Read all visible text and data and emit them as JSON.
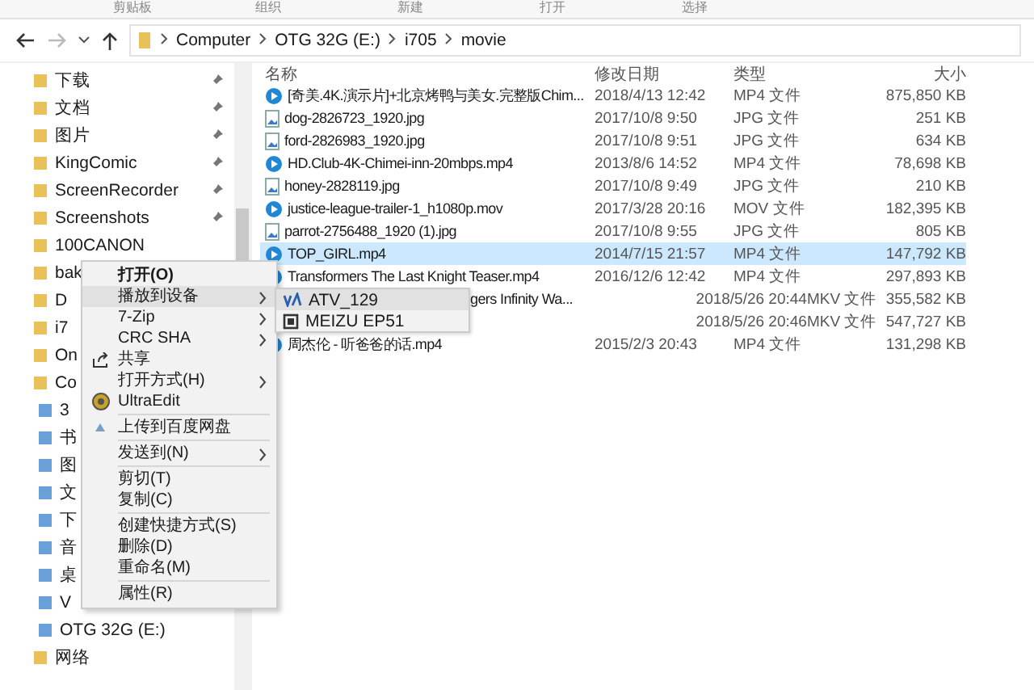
{
  "ribbon": {
    "groups": [
      "剪贴板",
      "组织",
      "新建",
      "打开",
      "选择"
    ]
  },
  "address_bar": {
    "path": [
      "Computer",
      "OTG 32G (E:)",
      "i705",
      "movie"
    ]
  },
  "sidebar": {
    "items": [
      {
        "label": "下载",
        "pinned": true
      },
      {
        "label": "文档",
        "pinned": true
      },
      {
        "label": "图片",
        "pinned": true
      },
      {
        "label": "KingComic",
        "pinned": true
      },
      {
        "label": "ScreenRecorder",
        "pinned": true
      },
      {
        "label": "Screenshots",
        "pinned": true
      },
      {
        "label": "100CANON",
        "pinned": false
      },
      {
        "label": "bak"
      },
      {
        "label": "D"
      },
      {
        "label": "i7"
      },
      {
        "label": "On"
      },
      {
        "label": "Co",
        "children": [
          {
            "label": "3"
          },
          {
            "label": "书"
          },
          {
            "label": "图"
          },
          {
            "label": "文"
          },
          {
            "label": "下"
          },
          {
            "label": "音"
          },
          {
            "label": "桌"
          },
          {
            "label": "V"
          },
          {
            "label": "OTG 32G (E:)"
          }
        ]
      },
      {
        "label": "网络"
      }
    ]
  },
  "table": {
    "columns": [
      "名称",
      "修改日期",
      "类型",
      "大小"
    ],
    "rows": [
      {
        "kind": "video",
        "name": "[奇美.4K.演示片]+北京烤鸭与美女.完整版Chim...",
        "date": "2018/4/13 12:42",
        "type": "MP4 文件",
        "size": "875,850 KB",
        "selected": false
      },
      {
        "kind": "image",
        "name": "dog-2826723_1920.jpg",
        "date": "2017/10/8 9:50",
        "type": "JPG 文件",
        "size": "251 KB",
        "selected": false
      },
      {
        "kind": "image",
        "name": "ford-2826983_1920.jpg",
        "date": "2017/10/8 9:51",
        "type": "JPG 文件",
        "size": "634 KB",
        "selected": false
      },
      {
        "kind": "video",
        "name": "HD.Club-4K-Chimei-inn-20mbps.mp4",
        "date": "2013/8/6 14:52",
        "type": "MP4 文件",
        "size": "78,698 KB",
        "selected": false
      },
      {
        "kind": "image",
        "name": "honey-2828119.jpg",
        "date": "2017/10/8 9:49",
        "type": "JPG 文件",
        "size": "210 KB",
        "selected": false
      },
      {
        "kind": "video",
        "name": "justice-league-trailer-1_h1080p.mov",
        "date": "2017/3/28 20:16",
        "type": "MOV 文件",
        "size": "182,395 KB",
        "selected": false
      },
      {
        "kind": "image",
        "name": "parrot-2756488_1920 (1).jpg",
        "date": "2017/10/8 9:55",
        "type": "JPG 文件",
        "size": "805 KB",
        "selected": false
      },
      {
        "kind": "video",
        "name": "TOP_GIRL.mp4",
        "date": "2014/7/15 21:57",
        "type": "MP4 文件",
        "size": "147,792 KB",
        "selected": true
      },
      {
        "kind": "video",
        "name": "Transformers The Last Knight Teaser.mp4",
        "date": "2016/12/6 12:42",
        "type": "MP4 文件",
        "size": "297,893 KB",
        "selected": false
      },
      {
        "kind": "covered",
        "name": "gers Infinity Wa...",
        "date": "2018/5/26 20:44",
        "type": "MKV 文件",
        "size": "355,582 KB",
        "selected": false
      },
      {
        "kind": "covered",
        "date": "2018/5/26 20:46",
        "type": "MKV 文件",
        "size": "547,727 KB",
        "selected": false
      },
      {
        "kind": "video",
        "name": "周杰伦 - 听爸爸的话.mp4",
        "date": "2015/2/3 20:43",
        "type": "MP4 文件",
        "size": "131,298 KB",
        "selected": false
      }
    ]
  },
  "context_menu": {
    "items": [
      {
        "kind": "plain",
        "label": "打开(O)",
        "bold": true,
        "submenu": false,
        "selected": false
      },
      {
        "kind": "plain",
        "label": "播放到设备",
        "bold": false,
        "submenu": true,
        "selected": true
      },
      {
        "kind": "plain",
        "label": "7-Zip",
        "bold": false,
        "submenu": true,
        "selected": false
      },
      {
        "kind": "plain",
        "label": "CRC SHA",
        "bold": false,
        "submenu": true,
        "selected": false
      },
      {
        "kind": "share",
        "label": "共享",
        "bold": false,
        "submenu": false,
        "selected": false
      },
      {
        "kind": "plain",
        "label": "打开方式(H)",
        "bold": false,
        "submenu": true,
        "selected": false
      },
      {
        "kind": "app",
        "label": "UltraEdit",
        "bold": false,
        "submenu": false,
        "selected": false
      },
      {
        "kind": "separator"
      },
      {
        "kind": "upload",
        "label": "上传到百度网盘",
        "bold": false,
        "submenu": false,
        "selected": false
      },
      {
        "kind": "separator"
      },
      {
        "kind": "plain",
        "label": "发送到(N)",
        "bold": false,
        "submenu": true,
        "selected": false
      },
      {
        "kind": "separator"
      },
      {
        "kind": "plain",
        "label": "剪切(T)",
        "bold": false,
        "submenu": false,
        "selected": false
      },
      {
        "kind": "plain",
        "label": "复制(C)",
        "bold": false,
        "submenu": false,
        "selected": false
      },
      {
        "kind": "separator"
      },
      {
        "kind": "plain",
        "label": "创建快捷方式(S)",
        "bold": false,
        "submenu": false,
        "selected": false
      },
      {
        "kind": "plain",
        "label": "删除(D)",
        "bold": false,
        "submenu": false,
        "selected": false
      },
      {
        "kind": "plain",
        "label": "重命名(M)",
        "bold": false,
        "submenu": false,
        "selected": false
      },
      {
        "kind": "separator"
      },
      {
        "kind": "plain",
        "label": "属性(R)",
        "bold": false,
        "submenu": false,
        "selected": false
      }
    ]
  },
  "submenu": {
    "items": [
      {
        "kind": "tv",
        "label": "ATV_129",
        "selected": true
      },
      {
        "kind": "device",
        "label": "MEIZU EP51",
        "selected": false
      }
    ]
  }
}
